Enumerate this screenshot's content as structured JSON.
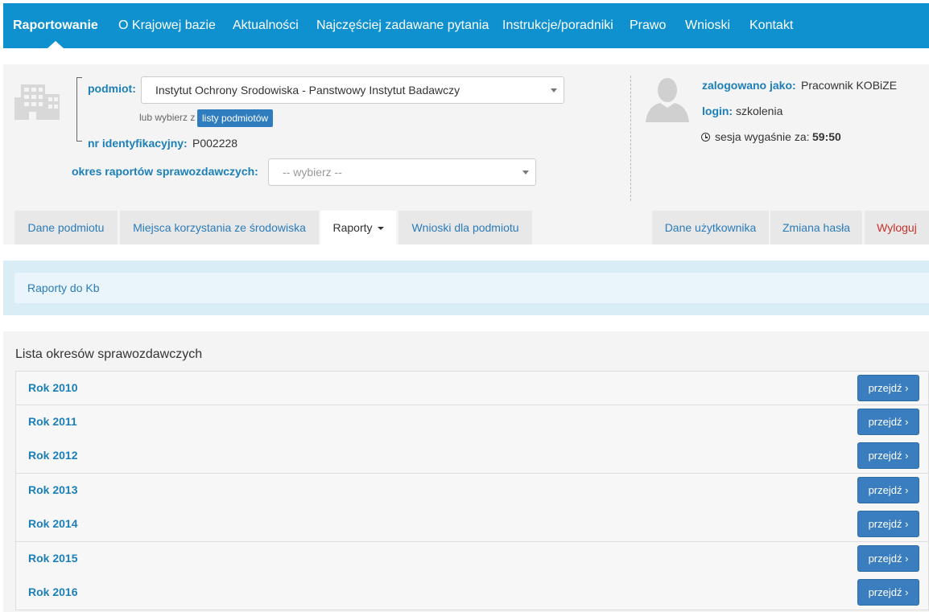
{
  "nav": {
    "items": [
      "Raportowanie",
      "O Krajowej bazie",
      "Aktualności",
      "Najczęściej zadawane pytania",
      "Instrukcje/poradniki",
      "Prawo",
      "Wnioski",
      "Kontakt"
    ]
  },
  "entity": {
    "label": "podmiot:",
    "selected": "Instytut Ochrony Srodowiska - Panstwowy Instytut Badawczy",
    "or_choose_text": "lub wybierz z",
    "list_button": "listy podmiotów",
    "id_label": "nr identyfikacyjny:",
    "id_value": "P002228",
    "period_label": "okres raportów sprawozdawczych:",
    "period_placeholder": "-- wybierz --"
  },
  "user": {
    "logged_label": "zalogowano jako:",
    "logged_value": "Pracownik KOBiZE",
    "login_label": "login:",
    "login_value": "szkolenia",
    "session_label": "sesja wygaśnie za:",
    "session_value": "59:50"
  },
  "tabs": {
    "left": [
      "Dane podmiotu",
      "Miejsca korzystania ze środowiska",
      "Raporty",
      "Wnioski dla podmiotu"
    ],
    "right": [
      "Dane użytkownika",
      "Zmiana hasła",
      "Wyloguj"
    ]
  },
  "breadcrumb": "Raporty do Kb",
  "list": {
    "title": "Lista okresów sprawozdawczych",
    "button_label": "przejdź ›",
    "items": [
      "Rok 2010",
      "Rok 2011",
      "Rok 2012",
      "Rok 2013",
      "Rok 2014",
      "Rok 2015",
      "Rok 2016"
    ]
  },
  "colors": {
    "navbar": "#0f91d0",
    "link": "#1c7fb8",
    "button": "#3a7ebf",
    "logout": "#c9302c"
  }
}
